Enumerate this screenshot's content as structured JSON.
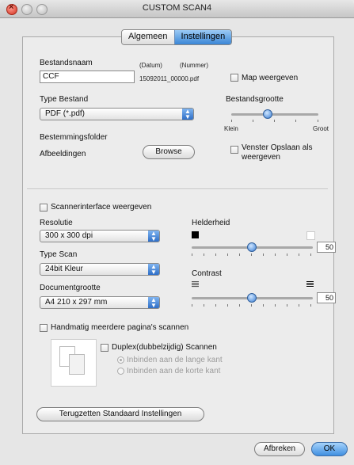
{
  "window": {
    "title": "CUSTOM SCAN4"
  },
  "tabs": [
    {
      "label": "Algemeen"
    },
    {
      "label": "Instellingen"
    }
  ],
  "filename": {
    "label": "Bestandsnaam",
    "value": "CCF",
    "date_label": "(Datum)",
    "number_label": "(Nummer)",
    "example": "15092011_00000.pdf",
    "show_folder_label": "Map weergeven"
  },
  "file_type": {
    "label": "Type Bestand",
    "value": "PDF (*.pdf)"
  },
  "file_size": {
    "label": "Bestandsgrootte",
    "min_label": "Klein",
    "max_label": "Groot",
    "level_percent": 50
  },
  "destination": {
    "label": "Bestemmingsfolder",
    "folder": "Afbeeldingen",
    "browse_label": "Browse",
    "show_save_window_label": "Venster Opslaan als weergeven"
  },
  "scanner_interface_label": "Scannerinterface weergeven",
  "resolution": {
    "label": "Resolutie",
    "value": "300 x 300 dpi"
  },
  "scan_type": {
    "label": "Type Scan",
    "value": "24bit Kleur"
  },
  "document_size": {
    "label": "Documentgrootte",
    "value": "A4  210 x 297 mm"
  },
  "brightness": {
    "label": "Helderheid",
    "value": "50"
  },
  "contrast": {
    "label": "Contrast",
    "value": "50"
  },
  "multi_page_label": "Handmatig meerdere pagina's scannen",
  "duplex": {
    "label": "Duplex(dubbelzijdig) Scannen",
    "long_edge": "Inbinden aan de lange kant",
    "short_edge": "Inbinden aan de korte kant"
  },
  "reset_label": "Terugzetten Standaard Instellingen",
  "cancel_label": "Afbreken",
  "ok_label": "OK"
}
